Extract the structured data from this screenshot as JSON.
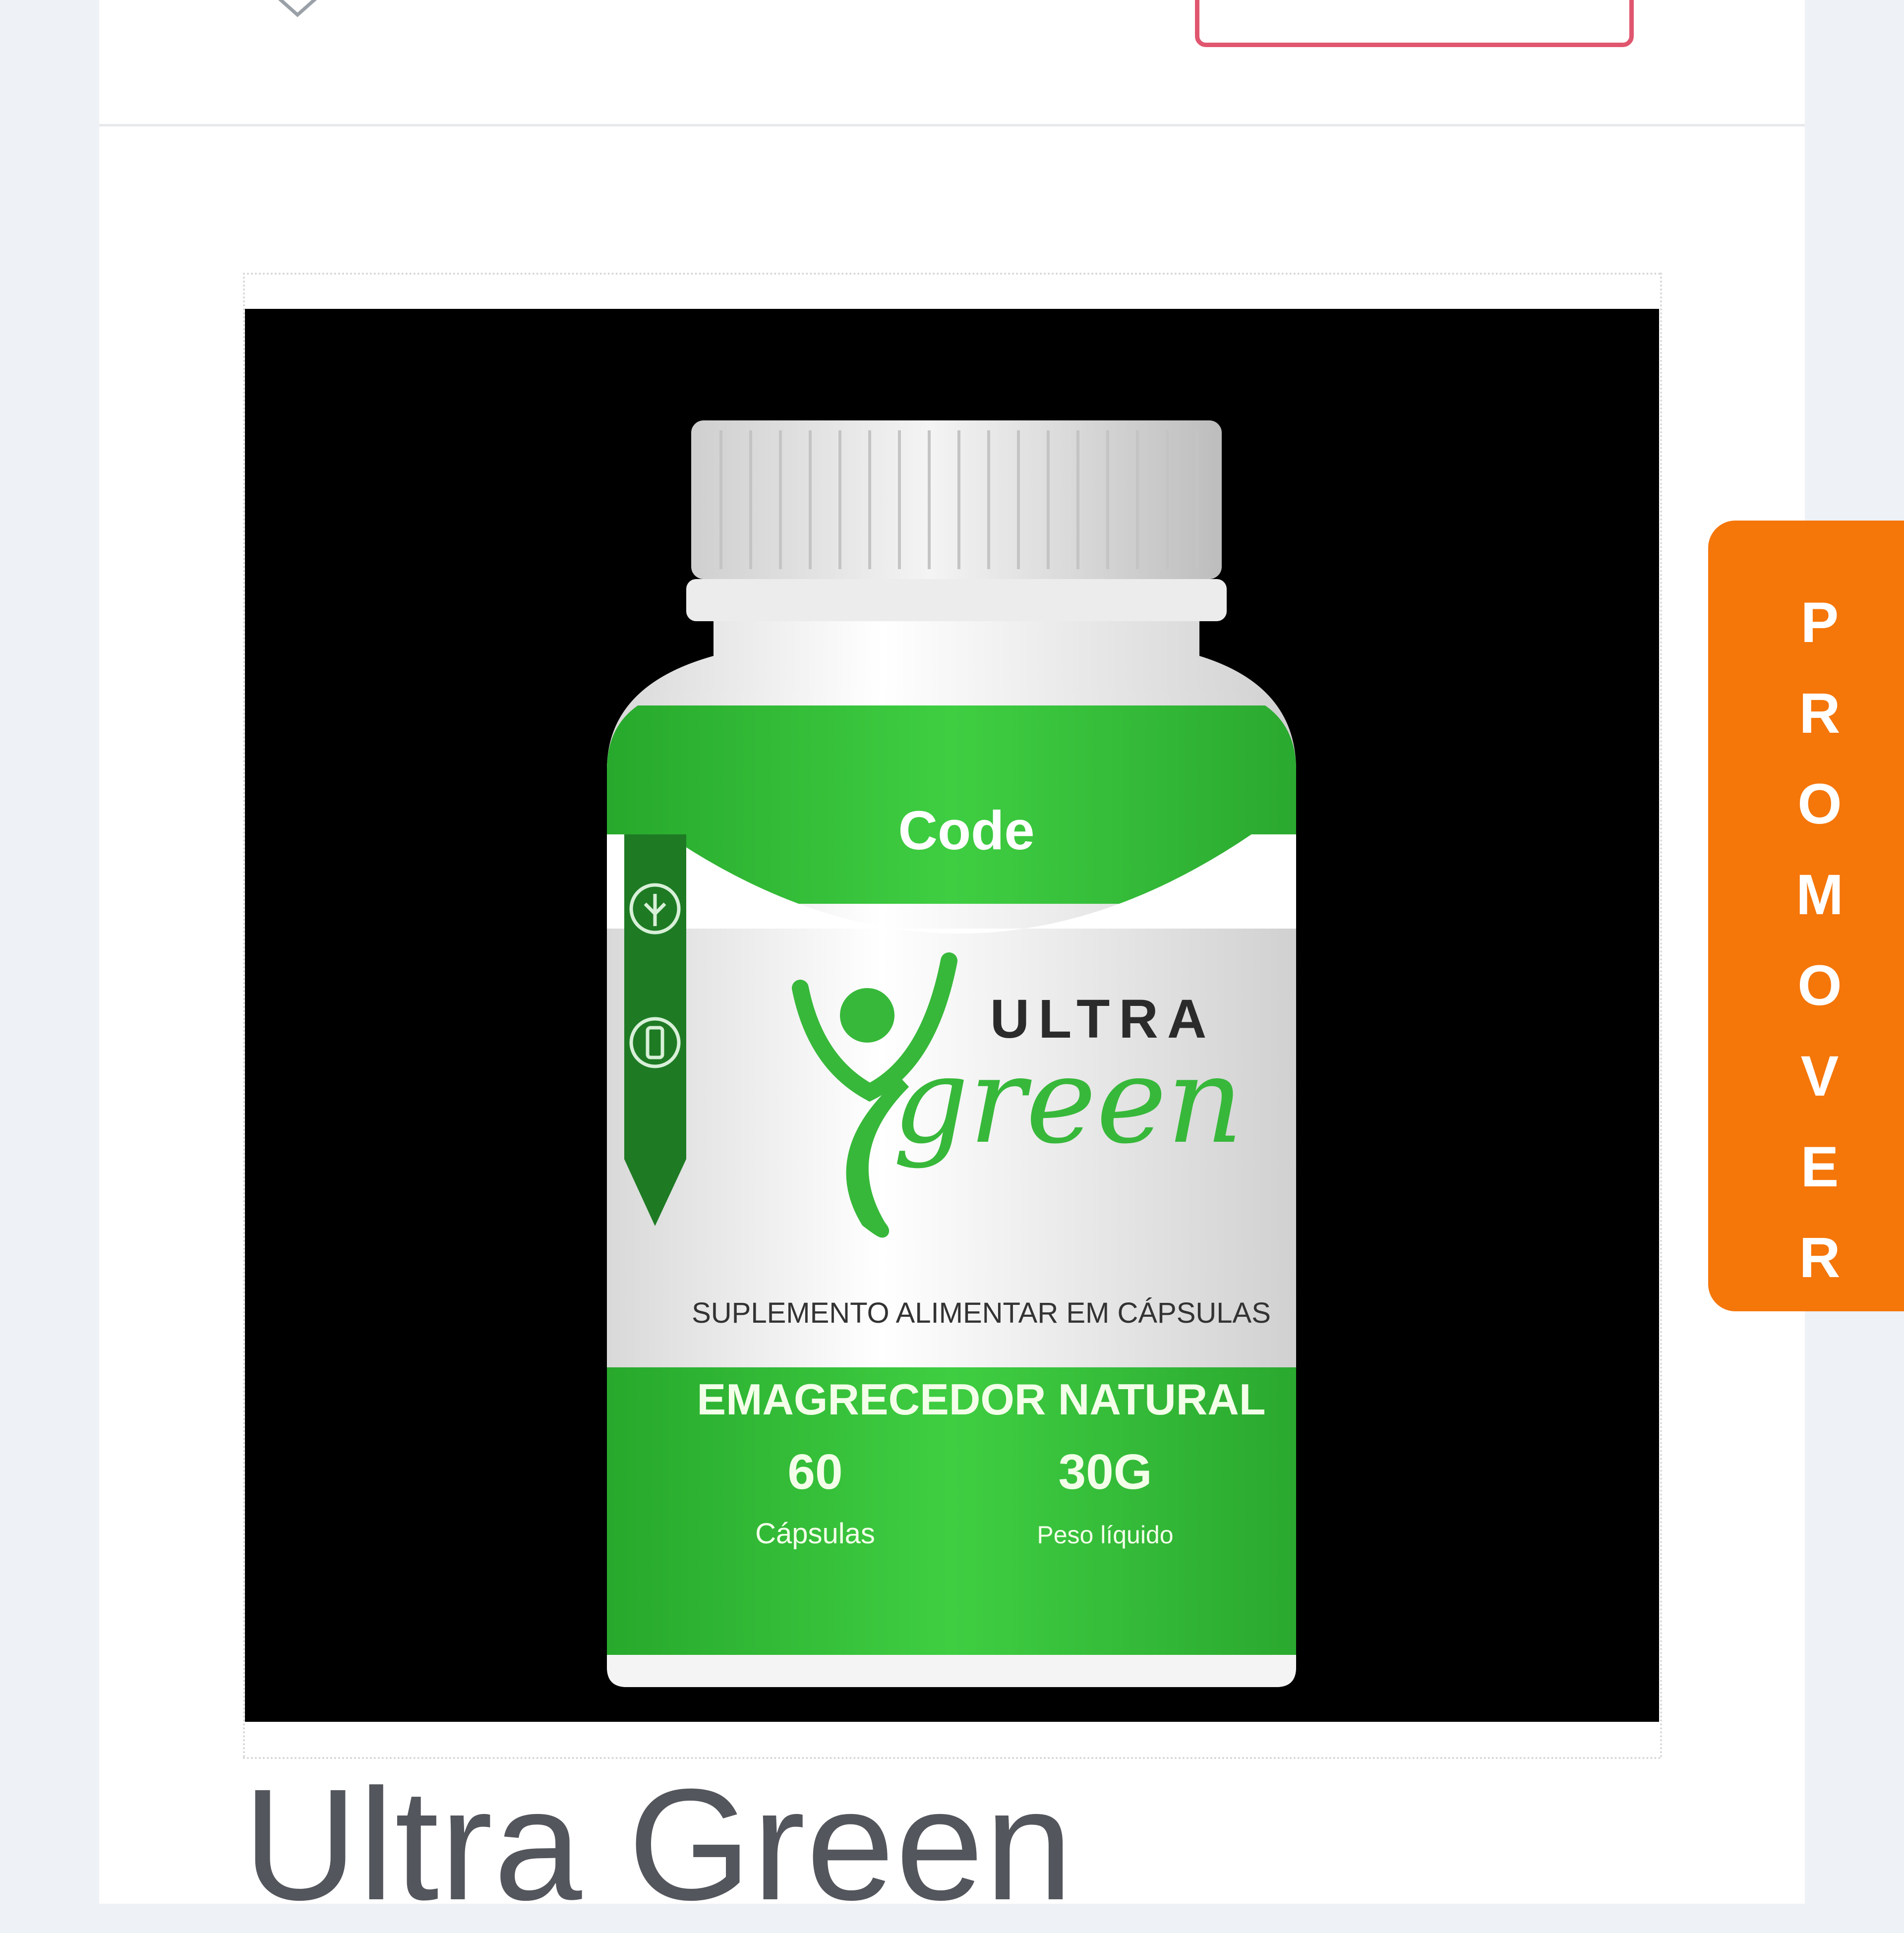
{
  "product": {
    "title": "Ultra Green",
    "image": {
      "brand": "Code",
      "logo_line1": "ULTRA",
      "logo_line2": "green",
      "subtitle": "SUPLEMENTO ALIMENTAR EM CÁPSULAS",
      "band_title": "EMAGRECEDOR NATURAL",
      "count_value": "60",
      "count_label": "Cápsulas",
      "weight_value": "30G",
      "weight_label": "Peso líquido"
    }
  },
  "promo_tab": {
    "letters": [
      "P",
      "R",
      "O",
      "M",
      "O",
      "V",
      "E",
      "R"
    ]
  },
  "colors": {
    "accent_orange": "#f57609",
    "header_button_border": "#e0566e",
    "title_text": "#54565d",
    "bottle_green": "#2fbf34"
  },
  "icons": {
    "header_chevron": "chevron-down-icon",
    "gluten_badge": "gluten-free-icon",
    "lactose_badge": "lactose-free-icon"
  }
}
